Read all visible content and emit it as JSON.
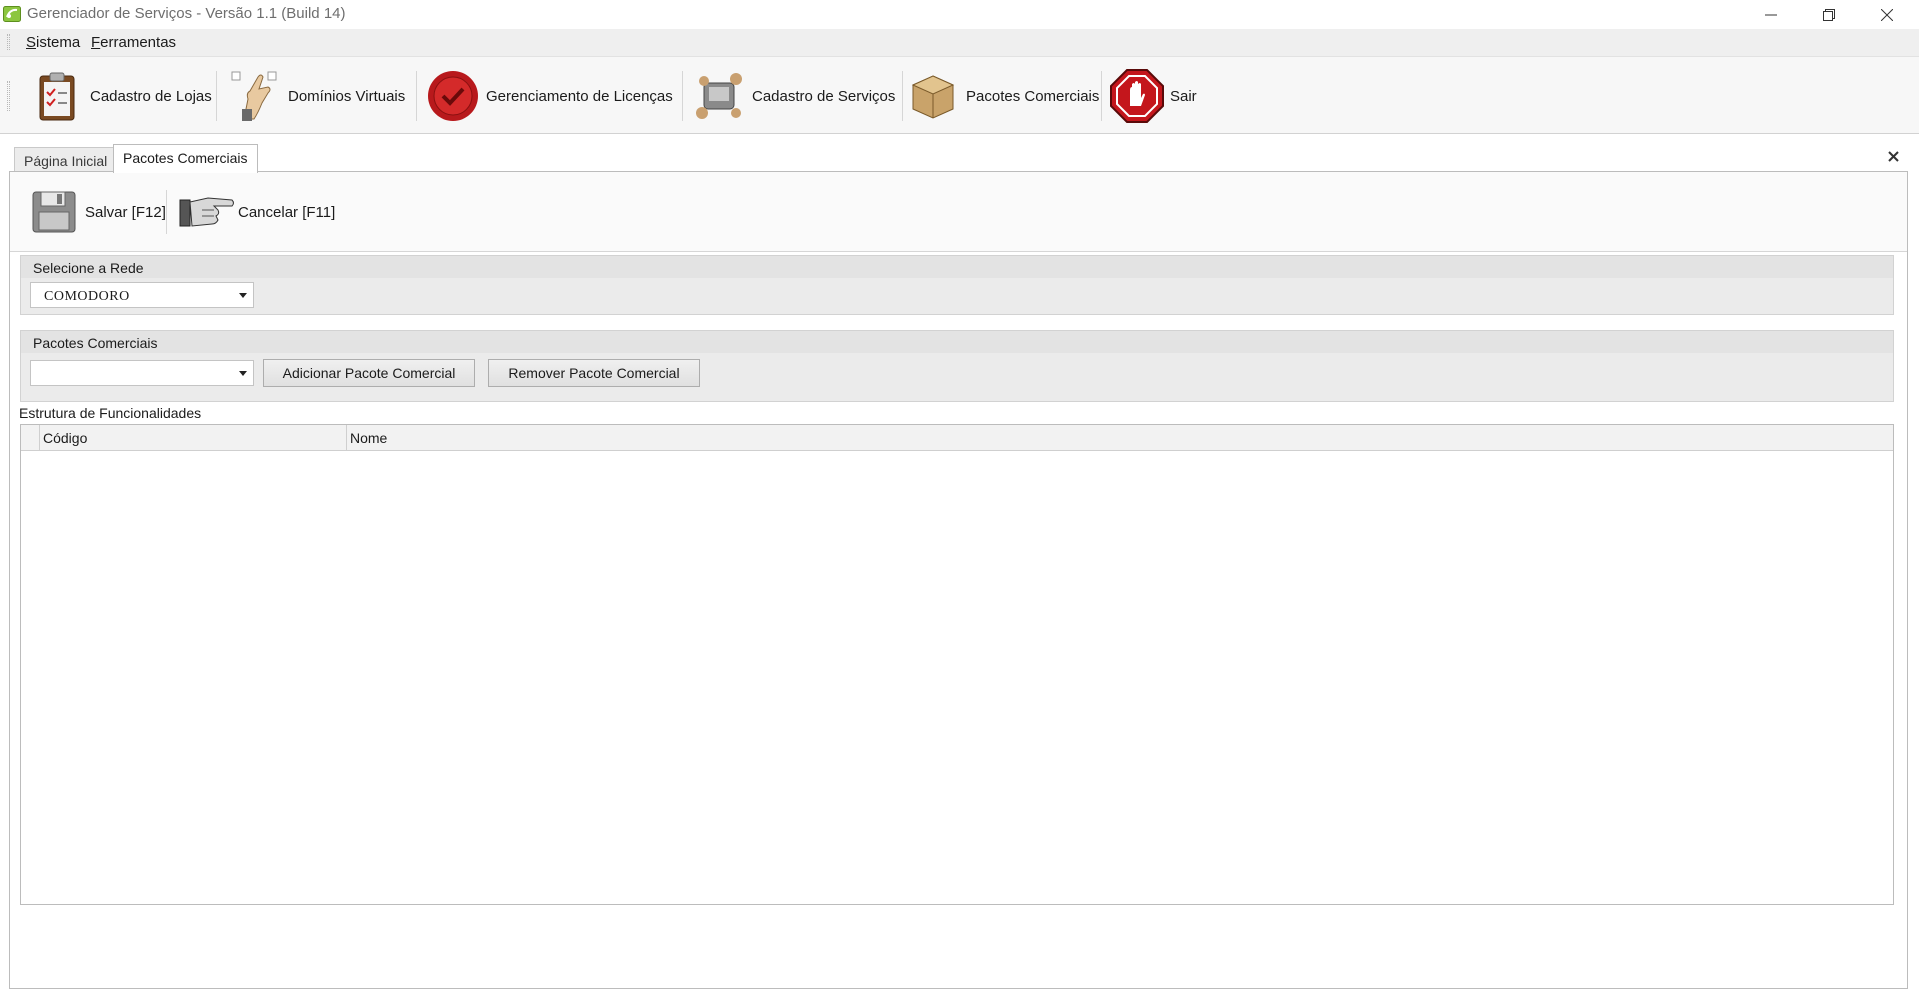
{
  "window": {
    "title": "Gerenciador de Serviços - Versão 1.1 (Build 14)",
    "controls": [
      "minimize-icon",
      "restore-icon",
      "close-icon"
    ]
  },
  "menu": {
    "items": [
      {
        "label": "Sistema",
        "accel": "S",
        "rest": "istema"
      },
      {
        "label": "Ferramentas",
        "accel": "F",
        "rest": "erramentas"
      }
    ]
  },
  "toolbar": {
    "items": [
      {
        "label": "Cadastro de Lojas",
        "icon": "clipboard-icon"
      },
      {
        "label": "Domínios Virtuais",
        "icon": "hand-pointer-icon"
      },
      {
        "label": "Gerenciamento de Licenças",
        "icon": "seal-check-icon"
      },
      {
        "label": "Cadastro de Serviços",
        "icon": "services-icon"
      },
      {
        "label": "Pacotes Comerciais",
        "icon": "package-icon"
      },
      {
        "label": "Sair",
        "icon": "stop-hand-icon"
      }
    ]
  },
  "tabs": [
    {
      "label": "Página Inicial",
      "active": false
    },
    {
      "label": "Pacotes Comerciais",
      "active": true
    }
  ],
  "form": {
    "toolbar": {
      "save_label": "Salvar [F12]",
      "cancel_label": "Cancelar [F11]"
    },
    "network_group": {
      "title": "Selecione a Rede",
      "selected": "COMODORO"
    },
    "packages_group": {
      "title": "Pacotes Comerciais",
      "selected": "",
      "add_label": "Adicionar Pacote Comercial",
      "remove_label": "Remover Pacote Comercial"
    },
    "structure": {
      "title": "Estrutura de Funcionalidades",
      "columns": [
        "Código",
        "Nome"
      ],
      "rows": []
    }
  },
  "colors": {
    "chrome_bg": "#efefef",
    "seal_red": "#b8191c",
    "stop_red": "#c4161c"
  }
}
